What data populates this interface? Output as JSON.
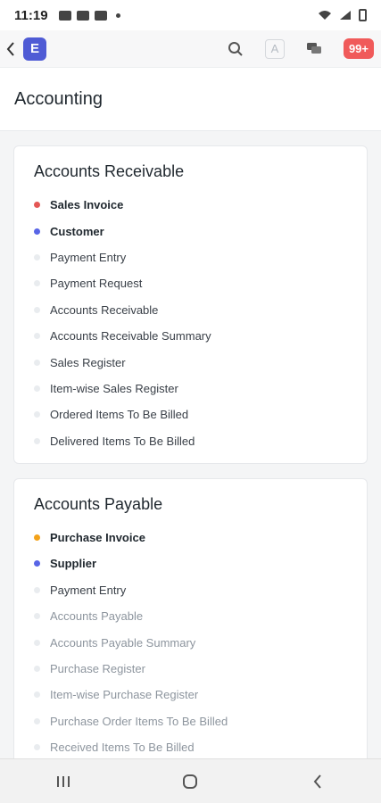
{
  "status": {
    "time": "11:19"
  },
  "header": {
    "logo_letter": "E",
    "badge": "99+",
    "avatar_letter": "A"
  },
  "page": {
    "title": "Accounting"
  },
  "colors": {
    "red": "#e45755",
    "blue": "#5865e6",
    "orange": "#f3a21a",
    "accent": "#4f5bd5"
  },
  "sections": [
    {
      "title": "Accounts Receivable",
      "items": [
        {
          "label": "Sales Invoice"
        },
        {
          "label": "Customer"
        },
        {
          "label": "Payment Entry"
        },
        {
          "label": "Payment Request"
        },
        {
          "label": "Accounts Receivable"
        },
        {
          "label": "Accounts Receivable Summary"
        },
        {
          "label": "Sales Register"
        },
        {
          "label": "Item-wise Sales Register"
        },
        {
          "label": "Ordered Items To Be Billed"
        },
        {
          "label": "Delivered Items To Be Billed"
        }
      ]
    },
    {
      "title": "Accounts Payable",
      "items": [
        {
          "label": "Purchase Invoice"
        },
        {
          "label": "Supplier"
        },
        {
          "label": "Payment Entry"
        },
        {
          "label": "Accounts Payable"
        },
        {
          "label": "Accounts Payable Summary"
        },
        {
          "label": "Purchase Register"
        },
        {
          "label": "Item-wise Purchase Register"
        },
        {
          "label": "Purchase Order Items To Be Billed"
        },
        {
          "label": "Received Items To Be Billed"
        }
      ]
    }
  ]
}
